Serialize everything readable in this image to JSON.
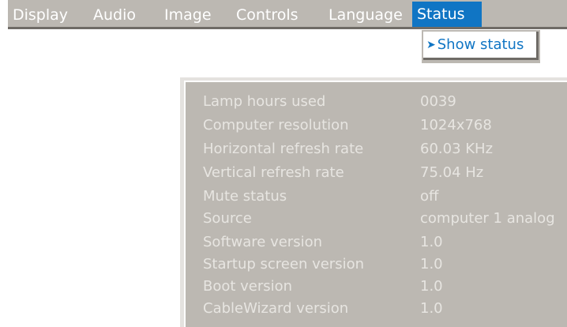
{
  "menu": {
    "items": [
      {
        "label": "Display"
      },
      {
        "label": "Audio"
      },
      {
        "label": "Image"
      },
      {
        "label": "Controls"
      },
      {
        "label": "Language"
      },
      {
        "label": "Status"
      }
    ],
    "active": "Status"
  },
  "submenu": {
    "arrow": "➤",
    "label": "Show status"
  },
  "status": {
    "rows": [
      {
        "label": "Lamp hours used",
        "value": "0039"
      },
      {
        "label": "Computer resolution",
        "value": "1024x768"
      },
      {
        "label": "Horizontal refresh rate",
        "value": "60.03 KHz"
      },
      {
        "label": "Vertical refresh rate",
        "value": "75.04 Hz"
      },
      {
        "label": "Mute status",
        "value": "off"
      },
      {
        "label": "Source",
        "value": "computer 1 analog"
      },
      {
        "label": "Software version",
        "value": "1.0"
      },
      {
        "label": "Startup screen version",
        "value": "1.0"
      },
      {
        "label": "Boot version",
        "value": "1.0"
      },
      {
        "label": "CableWizard version",
        "value": "1.0"
      }
    ]
  },
  "colors": {
    "accent": "#1075c4",
    "panel": "#bcb8b2",
    "text_light": "#e7e5e1"
  }
}
